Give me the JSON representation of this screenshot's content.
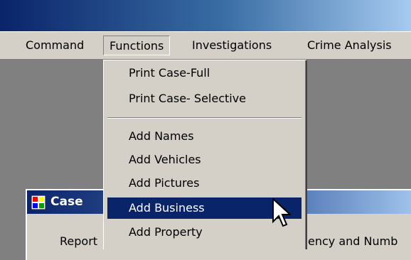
{
  "menubar": {
    "items": [
      "Command",
      "Functions",
      "Investigations",
      "Crime Analysis"
    ]
  },
  "functions_menu": {
    "group1": [
      "Print Case-Full",
      "Print Case- Selective"
    ],
    "group2": [
      "Add Names",
      "Add Vehicles",
      "Add Pictures",
      "Add Business",
      "Add Property"
    ],
    "highlighted": "Add Business"
  },
  "child_window": {
    "title": "Case",
    "icon": "grid-form-icon",
    "label_left": "Report",
    "label_right": "ency and Numb"
  },
  "colors": {
    "menu_bg": "#d4d0c8",
    "highlight": "#0a246a",
    "title_dark": "#0a246a",
    "title_light": "#a6caf0",
    "workspace": "#808080"
  },
  "cursor": "arrow-pointer-icon"
}
